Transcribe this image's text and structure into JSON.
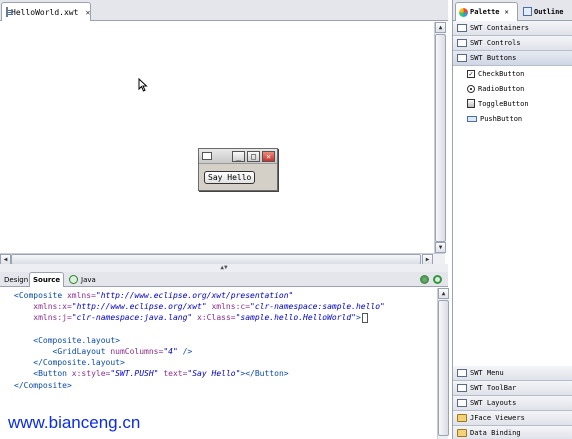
{
  "editor": {
    "tab_title": "HelloWorld.xwt",
    "tab_close": "✕"
  },
  "preview": {
    "button_label": "Say Hello",
    "min_glyph": "_",
    "max_glyph": "□",
    "close_glyph": "✕"
  },
  "bottom_tabs": {
    "design": "Design",
    "source": "Source",
    "java": "Java"
  },
  "source_lines": [
    [
      {
        "t": "tag",
        "v": "<Composite "
      },
      {
        "t": "attr",
        "v": "xmlns="
      },
      {
        "t": "val",
        "v": "\"http://www.eclipse.org/xwt/presentation\""
      }
    ],
    [
      {
        "t": "plain",
        "v": "    "
      },
      {
        "t": "attr",
        "v": "xmlns:x="
      },
      {
        "t": "val",
        "v": "\"http://www.eclipse.org/xwt\""
      },
      {
        "t": "plain",
        "v": " "
      },
      {
        "t": "attr",
        "v": "xmlns:c="
      },
      {
        "t": "val",
        "v": "\"clr-namespace:sample.hello\""
      }
    ],
    [
      {
        "t": "plain",
        "v": "    "
      },
      {
        "t": "attr",
        "v": "xmlns:j="
      },
      {
        "t": "val",
        "v": "\"clr-namespace:java.lang\""
      },
      {
        "t": "plain",
        "v": " "
      },
      {
        "t": "attr",
        "v": "x:Class="
      },
      {
        "t": "val",
        "v": "\"sample.hello.HelloWorld\""
      },
      {
        "t": "tag",
        "v": ">"
      }
    ],
    [],
    [
      {
        "t": "plain",
        "v": "    "
      },
      {
        "t": "tag",
        "v": "<Composite.layout>"
      }
    ],
    [
      {
        "t": "plain",
        "v": "        "
      },
      {
        "t": "tag",
        "v": "<GridLayout "
      },
      {
        "t": "attr",
        "v": "numColumns="
      },
      {
        "t": "val",
        "v": "\"4\""
      },
      {
        "t": "tag",
        "v": " />"
      }
    ],
    [
      {
        "t": "plain",
        "v": "    "
      },
      {
        "t": "tag",
        "v": "</Composite.layout>"
      }
    ],
    [
      {
        "t": "plain",
        "v": "    "
      },
      {
        "t": "tag",
        "v": "<Button "
      },
      {
        "t": "attr",
        "v": "x:style="
      },
      {
        "t": "val",
        "v": "\"SWT.PUSH\""
      },
      {
        "t": "plain",
        "v": " "
      },
      {
        "t": "attr",
        "v": "text="
      },
      {
        "t": "val",
        "v": "\"Say Hello\""
      },
      {
        "t": "tag",
        "v": "></Button>"
      }
    ],
    [
      {
        "t": "tag",
        "v": "</Composite>"
      }
    ]
  ],
  "watermark": "www.bianceng.cn",
  "palette": {
    "tab_palette": "Palette",
    "tab_outline": "Outline",
    "tab_close": "✕",
    "top_drawers": [
      "SWT Containers",
      "SWT Controls"
    ],
    "open_drawer": "SWT Buttons",
    "items": [
      {
        "label": "CheckButton",
        "icon": "checkbox-icon"
      },
      {
        "label": "RadioButton",
        "icon": "radio-icon"
      },
      {
        "label": "ToggleButton",
        "icon": "toggle-icon"
      },
      {
        "label": "PushButton",
        "icon": "push-button-icon"
      }
    ],
    "bottom_drawers": [
      "SWT Menu",
      "SWT ToolBar",
      "SWT Layouts",
      "JFace Viewers",
      "Data Binding"
    ]
  }
}
